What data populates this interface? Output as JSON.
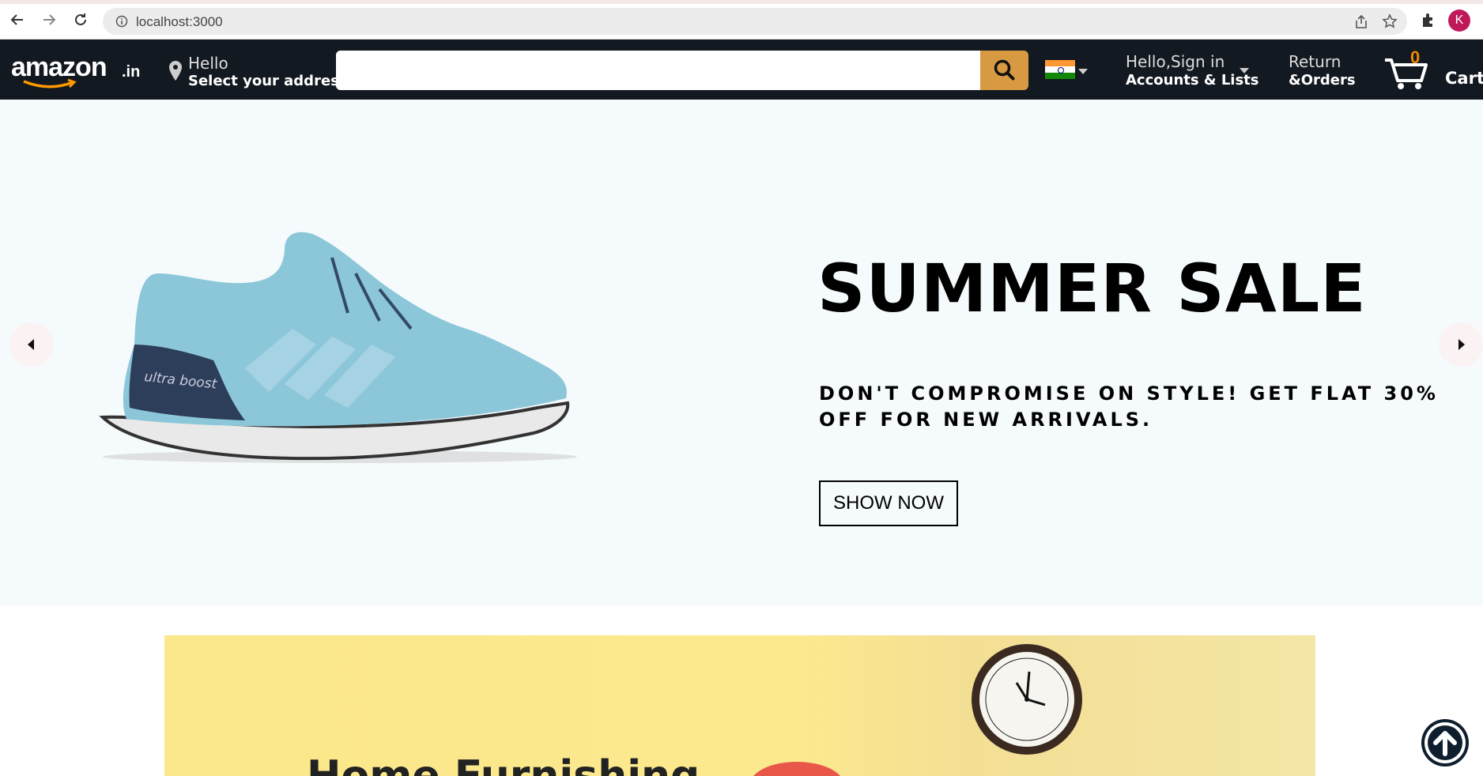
{
  "browser": {
    "url": "localhost:3000",
    "profile_initial": "K"
  },
  "header": {
    "logo_text": "amazon",
    "logo_tld": ".in",
    "address_greeting": "Hello",
    "address_prompt": "Select your address",
    "search_placeholder": "",
    "account_greeting": "Hello,Sign in",
    "account_label": "Accounts & Lists",
    "returns_line1": "Return",
    "returns_line2": "&Orders",
    "cart_count": "0",
    "cart_label": "Cart"
  },
  "hero": {
    "title": "SUMMER SALE",
    "description": "DON'T COMPROMISE ON STYLE! GET FLAT 30% OFF FOR NEW ARRIVALS.",
    "button_label": "SHOW NOW",
    "shoe_brand_text": "ultra boost"
  },
  "banner": {
    "partial_heading": "Home Furnishing"
  },
  "colors": {
    "nav_bg": "#131921",
    "search_button": "#d79a43",
    "cart_count": "#f08804",
    "hero_bg": "#f5fafd"
  }
}
